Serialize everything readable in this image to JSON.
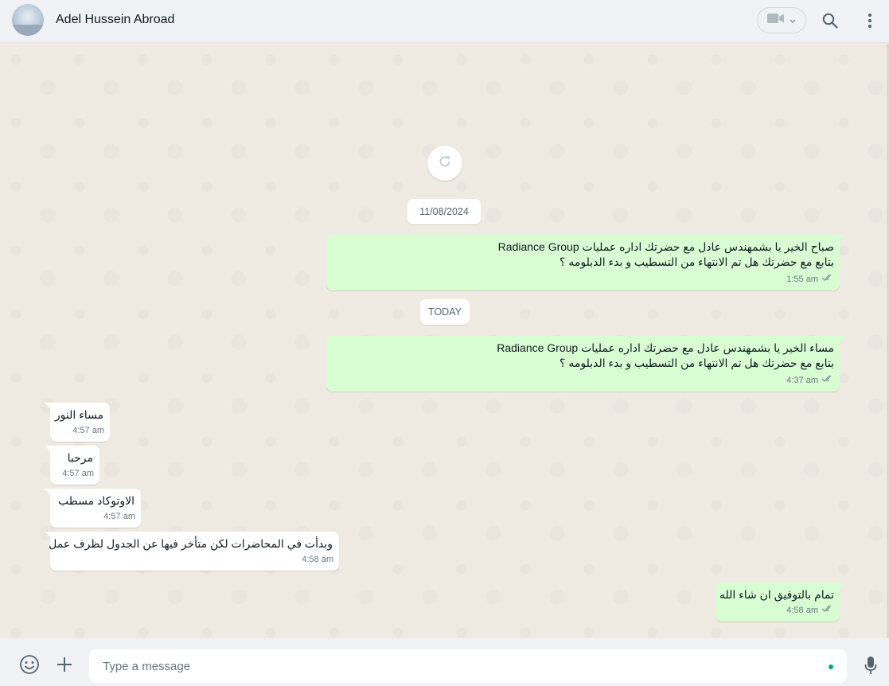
{
  "header": {
    "contact_name": "Adel Hussein Abroad"
  },
  "chat": {
    "date_separators": [
      "11/08/2024",
      "TODAY"
    ],
    "messages": [
      {
        "direction": "out",
        "text": "صباح الخير يا بشمهندس عادل مع  حضرتك اداره عمليات Radiance Group\nبتابع مع حضرتك هل تم الانتهاء من التسطيب و بدء الدبلومه ؟",
        "time": "1:55 am"
      },
      {
        "direction": "out",
        "text": "مساء  الخير يا بشمهندس عادل مع  حضرتك اداره عمليات Radiance Group\nبتابع مع حضرتك هل تم الانتهاء من التسطيب و بدء الدبلومه ؟",
        "time": "4:37 am"
      },
      {
        "direction": "in",
        "text": "مساء النور",
        "time": "4:57 am"
      },
      {
        "direction": "in",
        "text": "مرحبا",
        "time": "4:57 am"
      },
      {
        "direction": "in",
        "text": "الاوتوكاد مسطب",
        "time": "4:57 am"
      },
      {
        "direction": "in",
        "text": "وبدأت في المحاضرات لكن متأخر فيها عن الجدول لظرف عمل",
        "time": "4:58 am"
      },
      {
        "direction": "out",
        "text": "تمام بالتوفيق ان شاء الله",
        "time": "4:58 am"
      }
    ]
  },
  "composer": {
    "placeholder": "Type a message",
    "value": ""
  },
  "icons": {
    "video": "video-call-icon",
    "search": "search-icon",
    "menu": "menu-icon",
    "emoji": "emoji-icon",
    "attach": "attach-icon",
    "mic": "microphone-icon",
    "refresh": "refresh-icon",
    "read": "double-check-icon"
  },
  "colors": {
    "outgoing_bubble": "#d9fdd3",
    "incoming_bubble": "#ffffff",
    "chat_background": "#efeae2",
    "header_background": "#f0f2f5",
    "accent": "#00a884"
  }
}
